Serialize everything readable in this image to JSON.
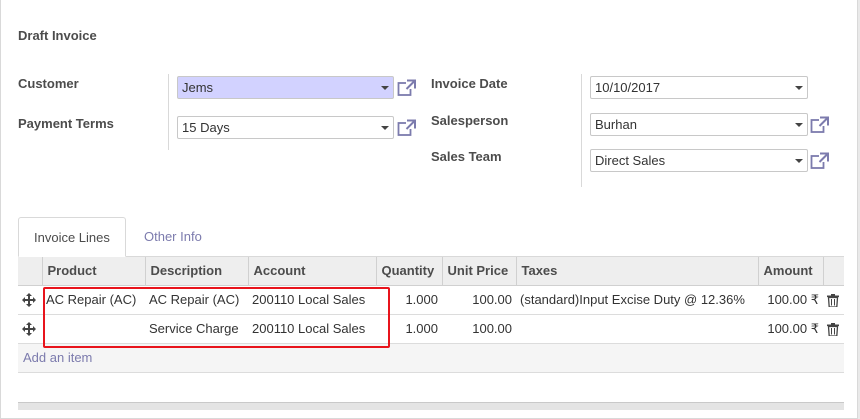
{
  "status": "Draft Invoice",
  "form": {
    "customer": {
      "label": "Customer",
      "value": "Jems"
    },
    "payment_terms": {
      "label": "Payment Terms",
      "value": "15 Days"
    },
    "invoice_date": {
      "label": "Invoice Date",
      "value": "10/10/2017"
    },
    "salesperson": {
      "label": "Salesperson",
      "value": "Burhan"
    },
    "sales_team": {
      "label": "Sales Team",
      "value": "Direct Sales"
    }
  },
  "tabs": {
    "invoice_lines": "Invoice Lines",
    "other_info": "Other Info"
  },
  "table": {
    "columns": {
      "product": "Product",
      "description": "Description",
      "account": "Account",
      "quantity": "Quantity",
      "unit_price": "Unit Price",
      "taxes": "Taxes",
      "amount": "Amount"
    },
    "rows": [
      {
        "product": "AC Repair (AC)",
        "description": "AC Repair (AC)",
        "account": "200110 Local Sales",
        "quantity": "1.000",
        "unit_price": "100.00",
        "taxes": "(standard)Input Excise Duty @ 12.36%",
        "amount": "100.00 ₹"
      },
      {
        "product": "",
        "description": "Service Charge",
        "account": "200110 Local Sales",
        "quantity": "1.000",
        "unit_price": "100.00",
        "taxes": "",
        "amount": "100.00 ₹"
      }
    ],
    "add_item": "Add an item"
  },
  "colors": {
    "link": "#7c7bad",
    "highlight_field": "#d2d2ff",
    "annotation": "#e8141c"
  }
}
